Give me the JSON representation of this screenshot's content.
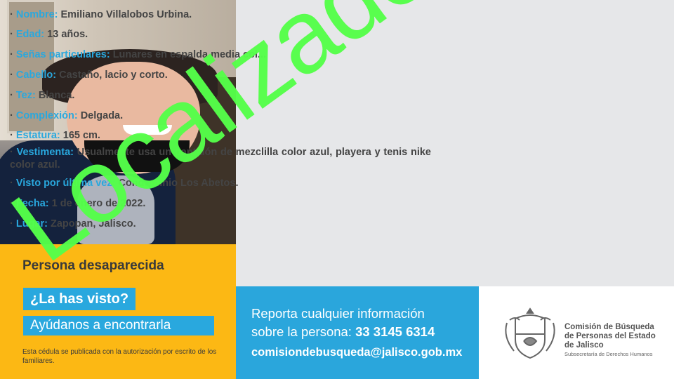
{
  "info": {
    "rows": [
      {
        "key": "Nombre:",
        "value": "Emiliano Villalobos Urbina."
      },
      {
        "key": "Edad:",
        "value": "13 años."
      },
      {
        "key": "Señas particulares:",
        "value": "Lunares en espalda media col..."
      },
      {
        "key": "Cabello:",
        "value": "Castaño, lacio y corto."
      },
      {
        "key": "Tez:",
        "value": "Blanca."
      },
      {
        "key": "Complexión:",
        "value": "Delgada."
      },
      {
        "key": "Estatura:",
        "value": "165 cm."
      },
      {
        "key": "Vestimenta:",
        "value": "Usualmente usa un pantalón de mezclilla color azul, playera y tenis nike color azul."
      },
      {
        "key": "Visto por última vez:",
        "value": "Condominio Los Abetos."
      },
      {
        "key": "Fecha:",
        "value": "1 de enero de 2022."
      },
      {
        "key": "Lugar:",
        "value": "Zapopan, Jalisco."
      }
    ]
  },
  "yellow": {
    "title": "Persona desaparecida",
    "question": "¿La has visto?",
    "help": "Ayúdanos a encontrarla",
    "note": "Esta cédula se publicada con la autorización por escrito de los familiares."
  },
  "blue": {
    "line1": "Reporta cualquier información",
    "line2_prefix": "sobre la persona: ",
    "phone": "33 3145 6314",
    "email": "comisiondebusqueda@jalisco.gob.mx"
  },
  "commission": {
    "line1": "Comisión de Búsqueda",
    "line2": "de Personas del Estado",
    "line3": "de Jalisco",
    "line4": "Subsecretaría de Derechos Humanos"
  },
  "stamp": "Localizado",
  "colors": {
    "accent_blue": "#29a8de",
    "yellow": "#fcb814",
    "stamp_green": "#55ff4a"
  }
}
